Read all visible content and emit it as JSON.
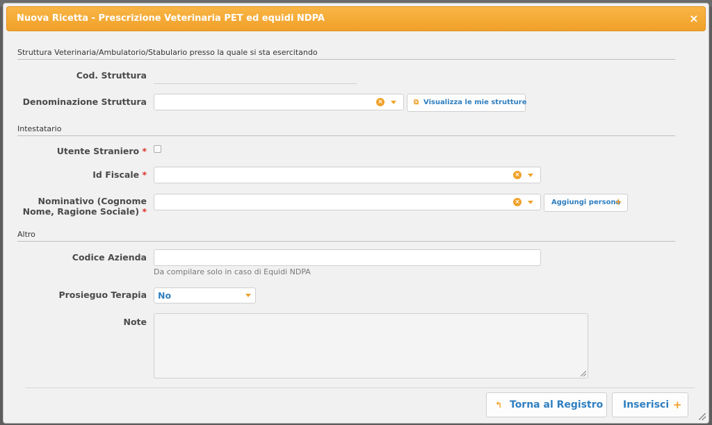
{
  "dialog": {
    "title": "Nuova Ricetta - Prescrizione Veterinaria PET ed equidi NDPA",
    "close_glyph": "×"
  },
  "sections": {
    "struttura": "Struttura Veterinaria/Ambulatorio/Stabulario presso la quale si sta esercitando",
    "intestatario": "Intestatario",
    "altro": "Altro"
  },
  "fields": {
    "cod_struttura_label": "Cod. Struttura",
    "cod_struttura_value": "",
    "denominazione_label": "Denominazione Struttura",
    "denominazione_value": "",
    "visualizza_btn": "Visualizza le mie strutture",
    "utente_straniero_label": "Utente Straniero",
    "utente_straniero_checked": false,
    "id_fiscale_label": "Id Fiscale",
    "id_fiscale_value": "",
    "nominativo_label_line1": "Nominativo (Cognome",
    "nominativo_label_line2": "Nome, Ragione Sociale)",
    "nominativo_value": "",
    "aggiungi_btn": "Aggiungi persona",
    "codice_azienda_label": "Codice Azienda",
    "codice_azienda_value": "",
    "codice_azienda_hint": "Da compilare solo in caso di Equidi NDPA",
    "prosieguo_label": "Prosieguo Terapia",
    "prosieguo_value": "No",
    "note_label": "Note",
    "note_value": "",
    "required_mark": "*"
  },
  "footer": {
    "back_btn": "Torna al Registro",
    "back_icon": "↰",
    "insert_btn": "Inserisci",
    "plus_glyph": "+"
  },
  "colors": {
    "accent": "#f0a12a",
    "link": "#2f7fc0",
    "required": "#d9332a"
  }
}
